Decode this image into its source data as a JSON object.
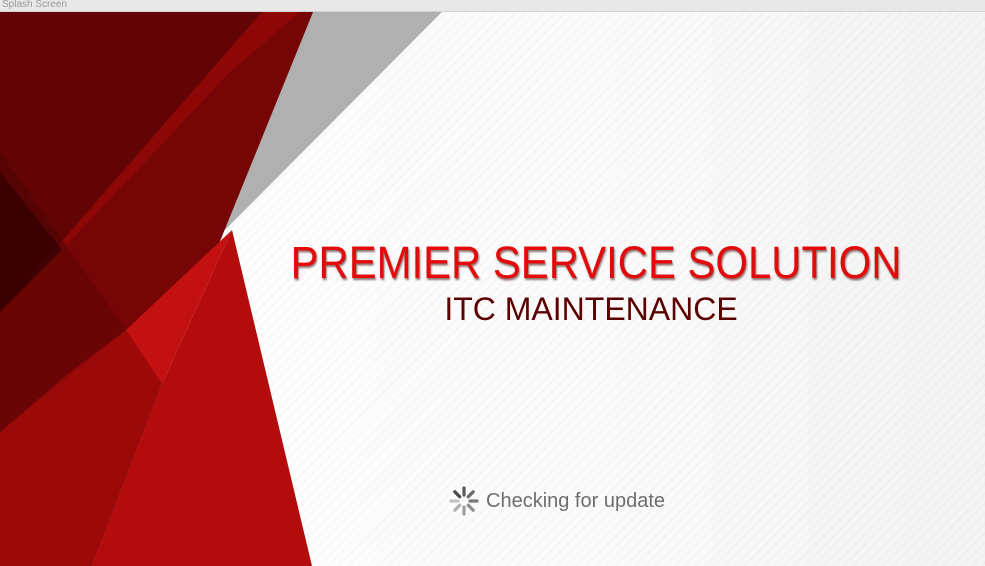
{
  "window": {
    "title": "Splash Screen"
  },
  "splash": {
    "title": "PREMIER SERVICE SOLUTION",
    "subtitle": "ITC MAINTENANCE",
    "status": "Checking for update"
  },
  "icons": {
    "spinner": "loading-spinner-icon"
  },
  "colors": {
    "title": "#e20a0a",
    "subtitle": "#5c0000",
    "status": "#6e6e6e",
    "dark_red": "#560505",
    "red": "#b40e0e",
    "gray": "#b0b0b0"
  }
}
